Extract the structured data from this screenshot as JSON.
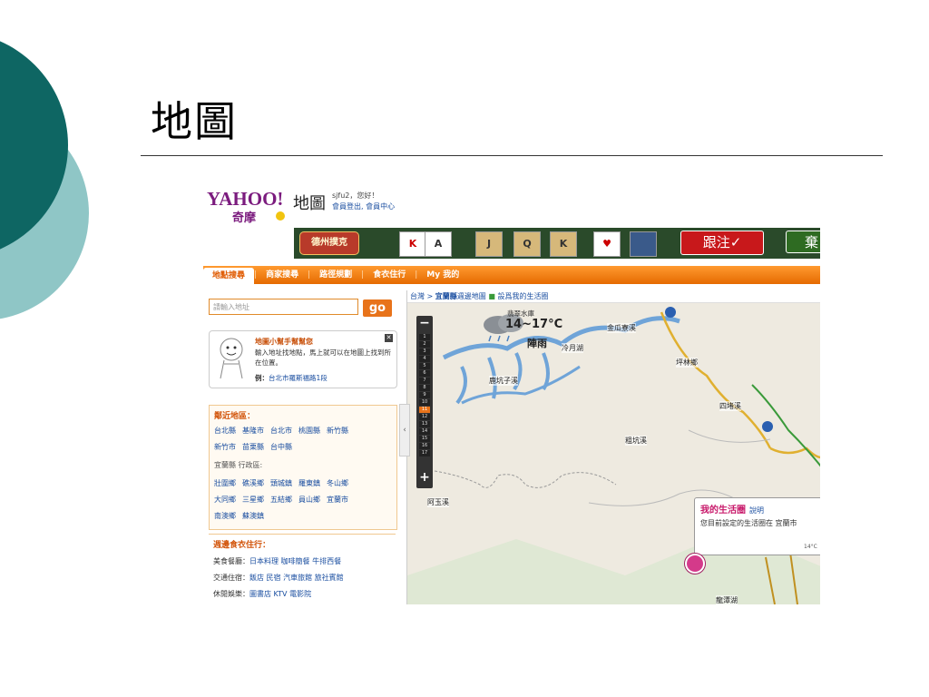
{
  "slide": {
    "title": "地圖"
  },
  "header": {
    "logo_text": "YAHOO!",
    "logo_cn": "奇摩",
    "map_title": "地圖",
    "greeting": "sjfu2，您好！",
    "user_links": "會員登出, 會員中心"
  },
  "banner": {
    "badge": "德州撲克",
    "follow_button": "跟注✓",
    "fold_button": "棄"
  },
  "nav": {
    "tabs": [
      "地點搜尋",
      "商家搜尋",
      "路徑規劃",
      "食衣住行",
      "My 我的"
    ]
  },
  "search": {
    "placeholder": "請輸入地址",
    "go_label": "go"
  },
  "helper": {
    "title": "地圖小幫手幫幫您",
    "body": "輸入地址找地點，馬上就可以在地圖上找到所在位置。",
    "example_label": "例：",
    "example_value": "台北市羅斯福路1段"
  },
  "nearby": {
    "title": "鄰近地區：",
    "row1": [
      "台北縣",
      "基隆市",
      "台北市",
      "桃園縣",
      "新竹縣"
    ],
    "row2": [
      "新竹市",
      "苗栗縣",
      "台中縣"
    ],
    "county_label": "宜蘭縣 行政區:",
    "row3": [
      "壯圍鄉",
      "礁溪鄉",
      "頭城鎮",
      "羅東鎮",
      "冬山鄉"
    ],
    "row4": [
      "大同鄉",
      "三星鄉",
      "五結鄉",
      "員山鄉",
      "宜蘭市"
    ],
    "row5": [
      "南澳鄉",
      "蘇澳鎮"
    ]
  },
  "weekly": {
    "title": "週邊食衣住行：",
    "food_label": "美食餐廳：",
    "food": "日本料理  咖啡簡餐  牛排西餐",
    "stay_label": "交通住宿：",
    "stay": "飯店  民宿  汽車旅館  旅社賓館",
    "fun_label": "休閒娛樂：",
    "fun": "圖書店  KTV  電影院"
  },
  "map": {
    "breadcrumb_region": "台灣",
    "breadcrumb_county": "宜蘭縣",
    "breadcrumb_rest": "週邊地圖",
    "set_life_circle": "設爲我的生活圈",
    "zoom_levels": [
      "1",
      "2",
      "3",
      "4",
      "5",
      "6",
      "7",
      "8",
      "9",
      "10",
      "11",
      "12",
      "13",
      "14",
      "15",
      "16",
      "17"
    ],
    "zoom_selected": "11",
    "weather": {
      "place": "翡翠水庫",
      "temp": "14~17°C",
      "condition": "陣雨"
    },
    "labels": [
      "金瓜寮溪",
      "冷月湖",
      "坪林鄉",
      "鹿坑子溪",
      "四堵溪",
      "粗坑溪",
      "阿玉溪",
      "龍潭湖"
    ],
    "life_circle": {
      "title": "我的生活圈",
      "help": "說明",
      "desc": "您目前設定的生活圈在 宜蘭市",
      "temp": "14°C"
    }
  }
}
